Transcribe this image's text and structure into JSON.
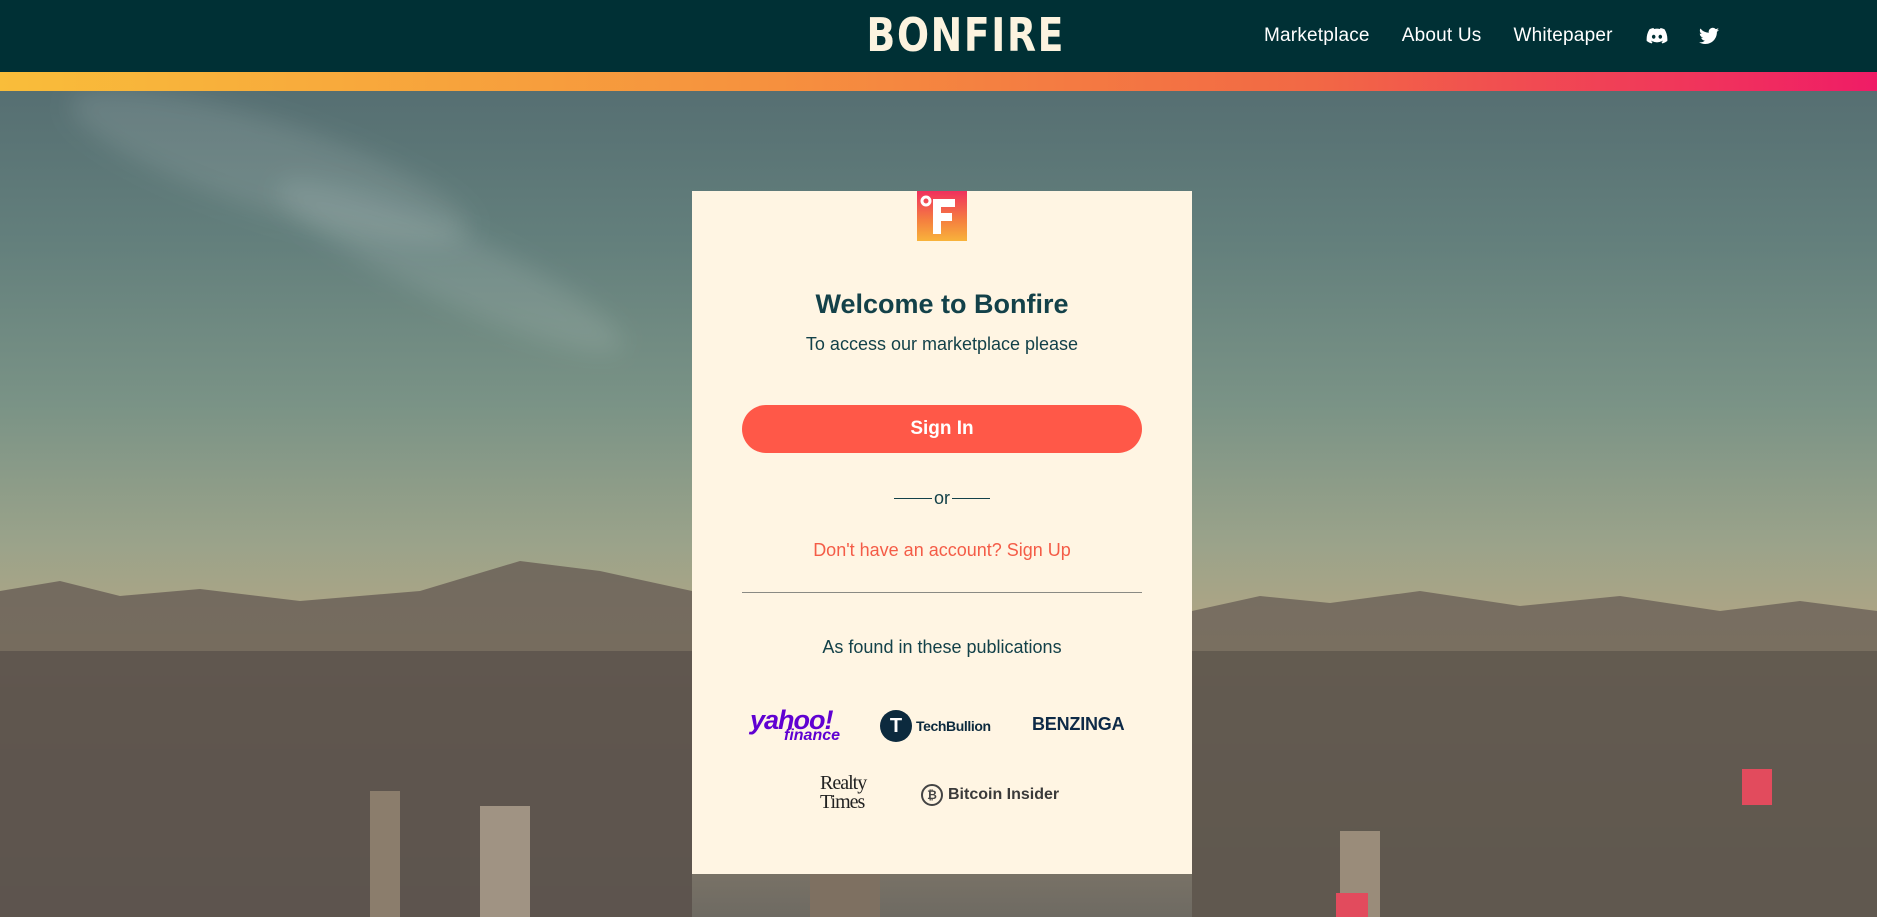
{
  "header": {
    "brand": "BONFIRE",
    "nav": [
      {
        "label": "Marketplace"
      },
      {
        "label": "About Us"
      },
      {
        "label": "Whitepaper"
      }
    ],
    "icons": [
      "discord-icon",
      "twitter-icon"
    ]
  },
  "card": {
    "logo_letter": "F",
    "title": "Welcome to Bonfire",
    "subtitle": "To access our marketplace please",
    "sign_in_label": "Sign In",
    "or_label": "or",
    "signup_label": "Don't have an account? Sign Up",
    "publications_title": "As found in these publications",
    "publications": {
      "yahoo": {
        "line1": "yahoo!",
        "line2": "finance"
      },
      "techbullion": {
        "mark": "T",
        "name": "TechBullion"
      },
      "benzinga": {
        "name": "BENZINGA"
      },
      "realty_times": {
        "line1": "Realty",
        "line2": "Times"
      },
      "bitcoin_insider": {
        "mark": "₿",
        "name": "Bitcoin Insider"
      }
    }
  },
  "colors": {
    "header_bg": "#003035",
    "card_bg": "#fff5e3",
    "primary_text": "#134149",
    "accent": "#ff5848"
  }
}
